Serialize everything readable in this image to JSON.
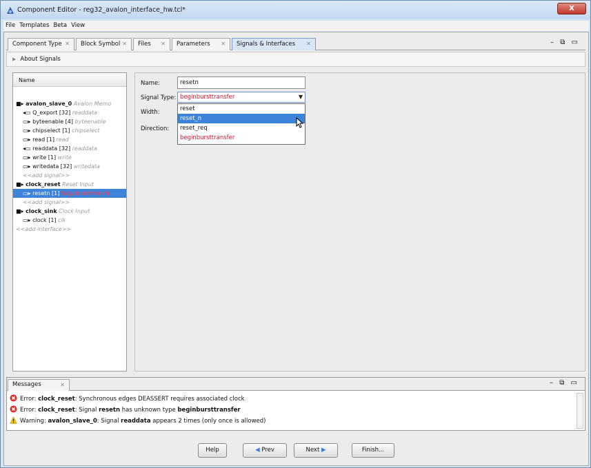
{
  "window": {
    "title": "Component Editor - reg32_avalon_interface_hw.tcl*",
    "close_glyph": "X"
  },
  "menu": [
    "File",
    "Templates",
    "Beta",
    "View"
  ],
  "tabs": [
    {
      "label": "Component Type",
      "close": "✕"
    },
    {
      "label": "Block Symbol",
      "close": "✕"
    },
    {
      "label": "Files",
      "close": "✕"
    },
    {
      "label": "Parameters",
      "close": "✕"
    },
    {
      "label": "Signals & Interfaces",
      "close": "✕"
    }
  ],
  "view_controls": "– ⧉ ▭",
  "about": {
    "label": "About Signals"
  },
  "tree": {
    "header": "Name",
    "rows": [
      {
        "glyph": "■▸",
        "name": "avalon_slave_0",
        "type": "Avalon Memo",
        "bold": true
      },
      {
        "glyph": "◂▭",
        "name": "Q_export [32]",
        "type": "readdata"
      },
      {
        "glyph": "▭▸",
        "name": "byteenable [4]",
        "type": "byteenable"
      },
      {
        "glyph": "▭▸",
        "name": "chipselect [1]",
        "type": "chipselect"
      },
      {
        "glyph": "▭▸",
        "name": "read [1]",
        "type": "read"
      },
      {
        "glyph": "◂▭",
        "name": "readdata [32]",
        "type": "readdata"
      },
      {
        "glyph": "▭▸",
        "name": "write [1]",
        "type": "write"
      },
      {
        "glyph": "▭▸",
        "name": "writedata [32]",
        "type": "writedata"
      },
      {
        "glyph": "",
        "name": "<<add signal>>",
        "type": "",
        "add": true
      },
      {
        "glyph": "■▸",
        "name": "clock_reset",
        "type": "Reset Input",
        "bold": true
      },
      {
        "glyph": "▭▸",
        "name": "resetn [1]",
        "type": "beginbursttransfe",
        "selected": true
      },
      {
        "glyph": "",
        "name": "<<add signal>>",
        "type": "",
        "add": true
      },
      {
        "glyph": "■▸",
        "name": "clock_sink",
        "type": "Clock Input",
        "bold": true
      },
      {
        "glyph": "▭▸",
        "name": "clock [1]",
        "type": "clk"
      },
      {
        "glyph": "",
        "name": "<<add interface>>",
        "type": "",
        "add": true
      }
    ]
  },
  "form": {
    "name_label": "Name:",
    "name_value": "resetn",
    "signal_type_label": "Signal Type:",
    "signal_type_value": "beginbursttransfer",
    "width_label": "Width:",
    "direction_label": "Direction:",
    "options": [
      "reset",
      "reset_n",
      "reset_req",
      "beginbursttransfer"
    ]
  },
  "messages": {
    "tab": "Messages",
    "rows": [
      {
        "level": "error",
        "prefix": "Error: ",
        "subject": "clock_reset",
        "text1": ": Synchronous edges DEASSERT requires associated clock",
        "key": "",
        "text2": ""
      },
      {
        "level": "error",
        "prefix": "Error: ",
        "subject": "clock_reset",
        "text1": ": Signal ",
        "key": "resetn",
        "text2": " has unknown type ",
        "key2": "beginbursttransfer",
        "text3": ""
      },
      {
        "level": "warning",
        "prefix": "Warning: ",
        "subject": "avalon_slave_0",
        "text1": ": Signal ",
        "key": "readdata",
        "text2": " appears 2 times (only once is allowed)",
        "key2": "",
        "text3": ""
      }
    ]
  },
  "buttons": {
    "help": "Help",
    "prev": "Prev",
    "next": "Next",
    "finish": "Finish..."
  },
  "colors": {
    "selection": "#3c83d9",
    "error_red": "#e0102a",
    "accent": "#2b5fb4"
  }
}
